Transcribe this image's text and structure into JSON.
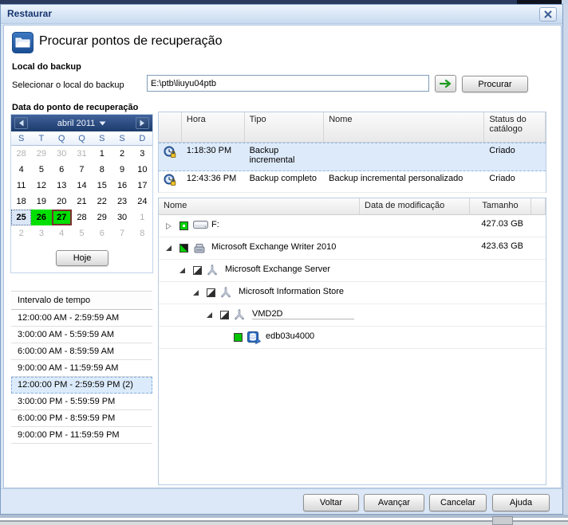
{
  "window": {
    "title": "Restaurar"
  },
  "header": {
    "title": "Procurar pontos de recuperação"
  },
  "backup_location": {
    "section_title": "Local do backup",
    "label": "Selecionar o local do backup",
    "path_value": "E:\\ptb\\liuyu04ptb",
    "browse_button": "Procurar"
  },
  "recovery_date": {
    "section_title": "Data do ponto de recuperação"
  },
  "calendar": {
    "month_label": "abril 2011",
    "weekdays": [
      "S",
      "T",
      "Q",
      "Q",
      "S",
      "S",
      "D"
    ],
    "days": [
      {
        "d": "28",
        "s": "muted"
      },
      {
        "d": "29",
        "s": "muted"
      },
      {
        "d": "30",
        "s": "muted"
      },
      {
        "d": "31",
        "s": "muted"
      },
      {
        "d": "1",
        "s": "normal"
      },
      {
        "d": "2",
        "s": "normal"
      },
      {
        "d": "3",
        "s": "normal"
      },
      {
        "d": "4",
        "s": "normal"
      },
      {
        "d": "5",
        "s": "normal"
      },
      {
        "d": "6",
        "s": "normal"
      },
      {
        "d": "7",
        "s": "normal"
      },
      {
        "d": "8",
        "s": "normal"
      },
      {
        "d": "9",
        "s": "normal"
      },
      {
        "d": "10",
        "s": "normal"
      },
      {
        "d": "11",
        "s": "normal"
      },
      {
        "d": "12",
        "s": "normal"
      },
      {
        "d": "13",
        "s": "normal"
      },
      {
        "d": "14",
        "s": "normal"
      },
      {
        "d": "15",
        "s": "normal"
      },
      {
        "d": "16",
        "s": "normal"
      },
      {
        "d": "17",
        "s": "normal"
      },
      {
        "d": "18",
        "s": "normal"
      },
      {
        "d": "19",
        "s": "normal"
      },
      {
        "d": "20",
        "s": "normal"
      },
      {
        "d": "21",
        "s": "normal"
      },
      {
        "d": "22",
        "s": "normal"
      },
      {
        "d": "23",
        "s": "normal"
      },
      {
        "d": "24",
        "s": "normal"
      },
      {
        "d": "25",
        "s": "selected"
      },
      {
        "d": "26",
        "s": "green"
      },
      {
        "d": "27",
        "s": "green-today"
      },
      {
        "d": "28",
        "s": "normal"
      },
      {
        "d": "29",
        "s": "normal"
      },
      {
        "d": "30",
        "s": "normal"
      },
      {
        "d": "1",
        "s": "muted"
      },
      {
        "d": "2",
        "s": "muted"
      },
      {
        "d": "3",
        "s": "muted"
      },
      {
        "d": "4",
        "s": "muted"
      },
      {
        "d": "5",
        "s": "muted"
      },
      {
        "d": "6",
        "s": "muted"
      },
      {
        "d": "7",
        "s": "muted"
      },
      {
        "d": "8",
        "s": "muted"
      }
    ],
    "today_button": "Hoje",
    "selection_green": "#00e000",
    "today_border": "#7c3030"
  },
  "time_range": {
    "header": "Intervalo de tempo",
    "items": [
      {
        "label": "12:00:00 AM - 2:59:59 AM",
        "selected": false
      },
      {
        "label": "3:00:00 AM - 5:59:59 AM",
        "selected": false
      },
      {
        "label": "6:00:00 AM - 8:59:59 AM",
        "selected": false
      },
      {
        "label": "9:00:00 AM - 11:59:59 AM",
        "selected": false
      },
      {
        "label": "12:00:00 PM - 2:59:59 PM (2)",
        "selected": true
      },
      {
        "label": "3:00:00 PM - 5:59:59 PM",
        "selected": false
      },
      {
        "label": "6:00:00 PM - 8:59:59 PM",
        "selected": false
      },
      {
        "label": "9:00:00 PM - 11:59:59 PM",
        "selected": false
      }
    ]
  },
  "recovery_points": {
    "columns": [
      "Hora",
      "Tipo",
      "Nome",
      "Status do catálogo"
    ],
    "rows": [
      {
        "icon": "backup-clock-lock-icon",
        "time": "1:18:30 PM",
        "type": "Backup incremental",
        "name": "",
        "status": "Criado",
        "selected": true
      },
      {
        "icon": "backup-clock-lock-icon",
        "time": "12:43:36 PM",
        "type": "Backup completo",
        "name": "Backup incremental personalizado",
        "status": "Criado",
        "selected": false
      }
    ]
  },
  "content_tree": {
    "columns": [
      "Nome",
      "Data de modificação",
      "Tamanho"
    ],
    "rows": [
      {
        "level": 0,
        "expander": "collapsed",
        "checkbox": "ring-green",
        "icon": "drive-icon",
        "name": "F:",
        "size": "427.03 GB",
        "underline": false
      },
      {
        "level": 0,
        "expander": "expanded",
        "checkbox": "diag-green",
        "icon": "writer-icon",
        "name": "Microsoft Exchange Writer 2010",
        "size": "423.63 GB",
        "underline": false
      },
      {
        "level": 1,
        "expander": "expanded",
        "checkbox": "diag-dark",
        "icon": "vss-icon",
        "name": "Microsoft Exchange Server",
        "size": "",
        "underline": false
      },
      {
        "level": 2,
        "expander": "expanded",
        "checkbox": "diag-dark",
        "icon": "vss-icon",
        "name": "Microsoft Information Store",
        "size": "",
        "underline": false
      },
      {
        "level": 3,
        "expander": "expanded",
        "checkbox": "diag-dark",
        "icon": "vss-icon",
        "name": "VMD2D",
        "size": "",
        "underline": true
      },
      {
        "level": 4,
        "expander": "none",
        "checkbox": "solid-green",
        "icon": "database-icon",
        "name": "edb03u4000",
        "size": "",
        "underline": false
      }
    ]
  },
  "footer": {
    "buttons": [
      "Voltar",
      "Avançar",
      "Cancelar",
      "Ajuda"
    ]
  },
  "colors": {
    "titlebar_text": "#16356e",
    "calendar_header": "#1c3b6b",
    "selected_row_bg": "#ddeafa",
    "green_arrow": "#1f9b1f"
  }
}
